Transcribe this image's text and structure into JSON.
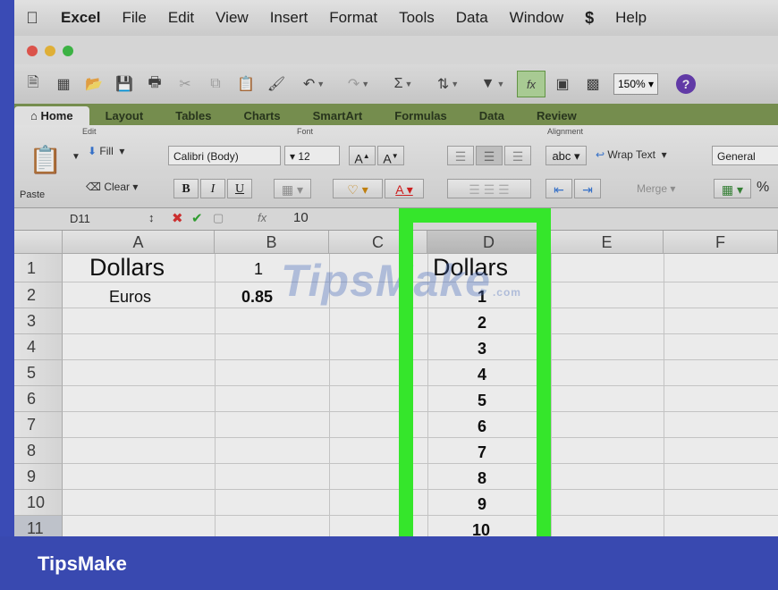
{
  "menubar": {
    "apple": "",
    "items": [
      "Excel",
      "File",
      "Edit",
      "View",
      "Insert",
      "Format",
      "Tools",
      "Data",
      "Window",
      "",
      "Help"
    ],
    "script_icon": "$"
  },
  "toolbar": {
    "zoom": "150%",
    "help": "?"
  },
  "ribbon_tabs": [
    "Home",
    "Layout",
    "Tables",
    "Charts",
    "SmartArt",
    "Formulas",
    "Data",
    "Review"
  ],
  "ribbon": {
    "edit_label": "Edit",
    "font_label": "Font",
    "alignment_label": "Alignment",
    "paste": "Paste",
    "fill": "Fill",
    "clear": "Clear",
    "font_name": "Calibri (Body)",
    "font_size": "12",
    "grow_font": "A",
    "shrink_font": "A",
    "bold": "B",
    "italic": "I",
    "underline": "U",
    "font_color": "A",
    "abc": "abc",
    "wrap_text": "Wrap Text",
    "merge": "Merge",
    "number_format": "General",
    "percent": "%"
  },
  "formula_bar": {
    "name_box": "D11",
    "fx": "fx",
    "value": "10"
  },
  "columns": [
    "A",
    "B",
    "C",
    "D",
    "E",
    "F"
  ],
  "rows": [
    "1",
    "2",
    "3",
    "4",
    "5",
    "6",
    "7",
    "8",
    "9",
    "10",
    "11"
  ],
  "cells": {
    "A1": "Dollars",
    "A2": "Euros",
    "B1": "1",
    "B2": "0.85",
    "D1": "Dollars",
    "D2": "1",
    "D3": "2",
    "D4": "3",
    "D5": "4",
    "D6": "5",
    "D7": "6",
    "D8": "7",
    "D9": "8",
    "D10": "9",
    "D11": "10"
  },
  "watermark": "TipsMake",
  "watermark_suffix": ".com",
  "footer_brand": "TipsMake",
  "colors": {
    "highlight": "#35e62b",
    "footer": "#3949b0",
    "ribbon_tabs": "#7f9a55"
  }
}
